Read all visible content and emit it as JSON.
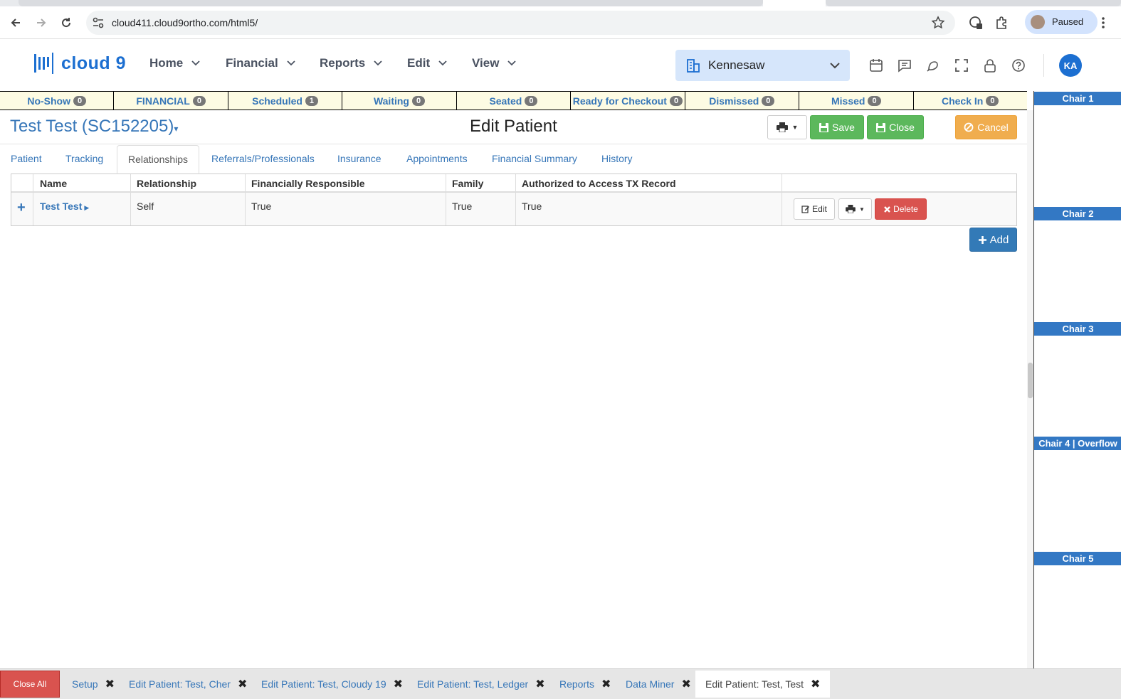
{
  "browser": {
    "url": "cloud411.cloud9ortho.com/html5/",
    "profile_status": "Paused"
  },
  "header": {
    "logo_text": "cloud 9",
    "nav": [
      "Home",
      "Financial",
      "Reports",
      "Edit",
      "View"
    ],
    "location": "Kennesaw",
    "user_initials": "KA"
  },
  "status_bar": [
    {
      "label": "No-Show",
      "count": "0"
    },
    {
      "label": "FINANCIAL",
      "count": "0"
    },
    {
      "label": "Scheduled",
      "count": "1"
    },
    {
      "label": "Waiting",
      "count": "0"
    },
    {
      "label": "Seated",
      "count": "0"
    },
    {
      "label": "Ready for Checkout",
      "count": "0"
    },
    {
      "label": "Dismissed",
      "count": "0"
    },
    {
      "label": "Missed",
      "count": "0"
    },
    {
      "label": "Check In",
      "count": "0"
    }
  ],
  "chairs": [
    "Chair 1",
    "Chair 2",
    "Chair 3",
    "Chair 4 | Overflow",
    "Chair 5"
  ],
  "page": {
    "patient_title": "Test Test (SC152205)",
    "title": "Edit Patient",
    "save_label": "Save",
    "close_label": "Close",
    "cancel_label": "Cancel",
    "add_label": "Add"
  },
  "tabs": [
    "Patient",
    "Tracking",
    "Relationships",
    "Referrals/Professionals",
    "Insurance",
    "Appointments",
    "Financial Summary",
    "History"
  ],
  "active_tab": "Relationships",
  "grid": {
    "columns": [
      "Name",
      "Relationship",
      "Financially Responsible",
      "Family",
      "Authorized to Access TX Record"
    ],
    "rows": [
      {
        "name": "Test Test",
        "relationship": "Self",
        "financially_responsible": "True",
        "family": "True",
        "authorized": "True"
      }
    ],
    "edit_label": "Edit",
    "delete_label": "Delete"
  },
  "taskbar": {
    "close_all": "Close All",
    "tabs": [
      "Setup",
      "Edit Patient: Test, Cher",
      "Edit Patient: Test, Cloudy 19",
      "Edit Patient: Test, Ledger",
      "Reports",
      "Data Miner",
      "Edit Patient: Test, Test"
    ]
  }
}
